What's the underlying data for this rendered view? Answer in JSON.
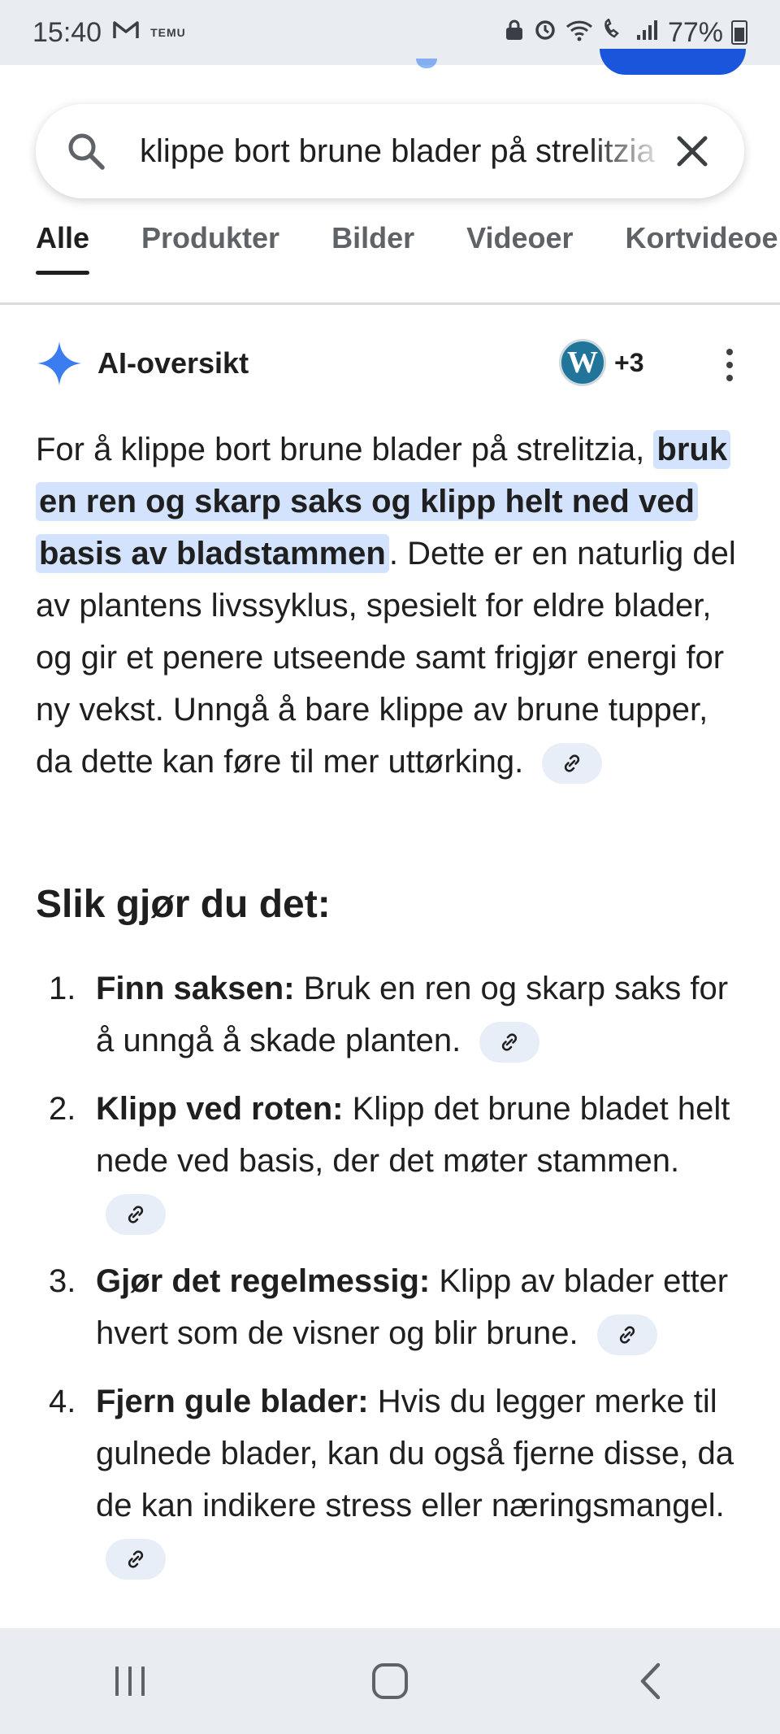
{
  "status_bar": {
    "time": "15:40",
    "notification_label": "TEMU",
    "battery": "77%"
  },
  "search": {
    "query": "klippe bort brune blader på strelitzia",
    "icon": "search-icon",
    "clear_icon": "close-icon"
  },
  "tabs": [
    {
      "label": "Alle",
      "active": true
    },
    {
      "label": "Produkter",
      "active": false
    },
    {
      "label": "Bilder",
      "active": false
    },
    {
      "label": "Videoer",
      "active": false
    },
    {
      "label": "Kortvideoer",
      "active": false
    }
  ],
  "ai_overview": {
    "title": "AI-oversikt",
    "source_logo_letter": "W",
    "sources_more": "+3",
    "intro_before": "For å klippe bort brune blader på strelitzia,",
    "intro_highlight": "bruk en ren og skarp saks og klipp helt ned ved basis av bladstammen",
    "intro_after": ". Dette er en naturlig del av plantens livssyklus, spesielt for eldre blader, og gir et penere utseende samt frigjør energi for ny vekst. Unngå å bare klippe av brune tupper, da dette kan føre til mer uttørking."
  },
  "howto": {
    "heading": "Slik gjør du det:",
    "steps": [
      {
        "num": "1.",
        "title": "Finn saksen:",
        "text": "Bruk en ren og skarp saks for å unngå å skade planten."
      },
      {
        "num": "2.",
        "title": "Klipp ved roten:",
        "text": "Klipp det brune bladet helt nede ved basis, der det møter stammen."
      },
      {
        "num": "3.",
        "title": "Gjør det regelmessig:",
        "text": "Klipp av blader etter hvert som de visner og blir brune."
      },
      {
        "num": "4.",
        "title": "Fjern gule blader:",
        "text": "Hvis du legger merke til gulnede blader, kan du også fjerne disse, da de kan indikere stress eller næringsmangel."
      }
    ]
  },
  "colors": {
    "accent_blue": "#1a56db",
    "highlight": "#d3e3fd",
    "chip": "#e8eef8"
  }
}
